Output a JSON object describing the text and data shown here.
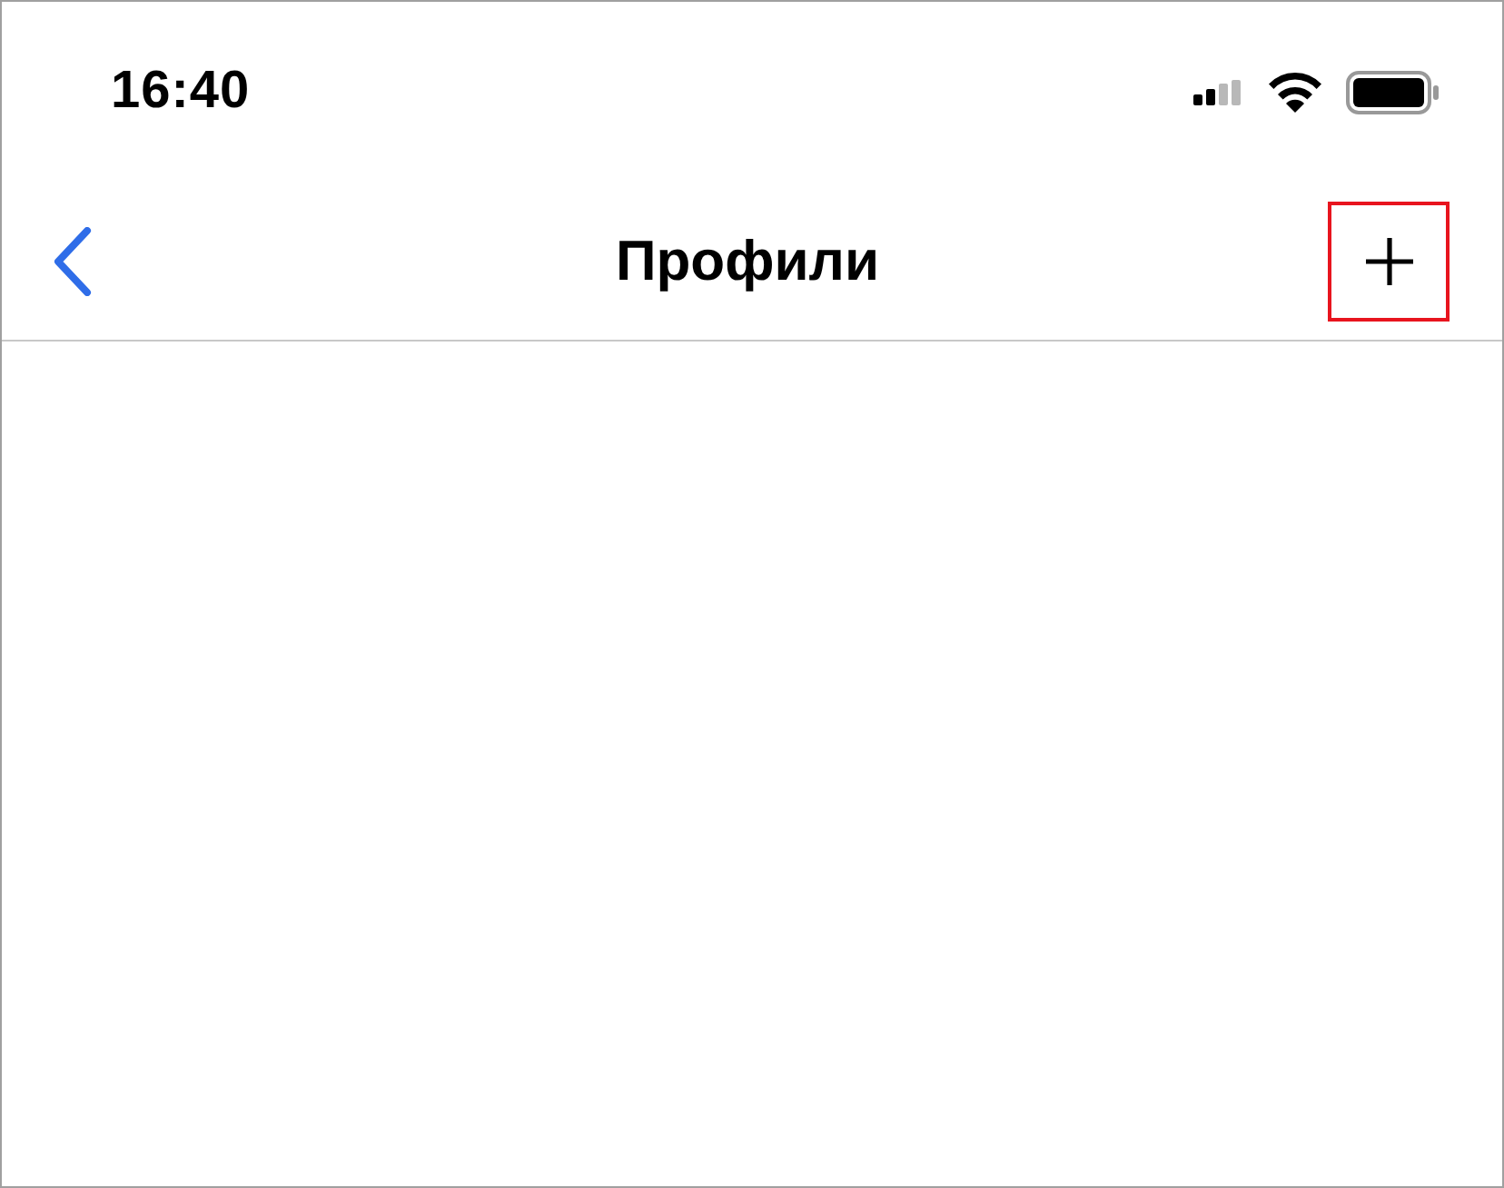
{
  "status_bar": {
    "time": "16:40"
  },
  "nav_bar": {
    "title": "Профили",
    "add_button": {
      "highlighted": true
    }
  }
}
